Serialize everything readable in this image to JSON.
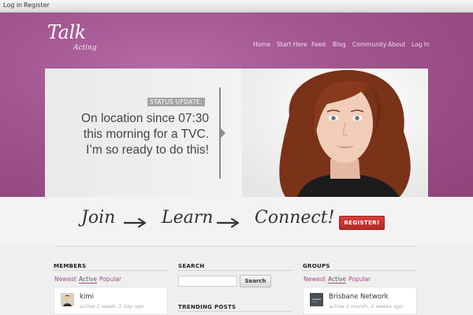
{
  "adminbar": {
    "login": "Log in",
    "register": "Register"
  },
  "logo": {
    "main": "Talk",
    "sub": "Acting"
  },
  "nav": [
    "Home",
    "Start Here",
    "Feed",
    "Blog",
    "Community",
    "About",
    "Log In"
  ],
  "hero": {
    "status_label": "STATUS UPDATE:",
    "lines": [
      "On location since 07:30",
      "this morning for a TVC.",
      "I’m so ready to do this!"
    ]
  },
  "join": {
    "step1": "Join",
    "step2": "Learn",
    "step3": "Connect!",
    "register_label": "REGISTER!"
  },
  "members": {
    "title": "MEMBERS",
    "tabs": [
      "Newest",
      "Active",
      "Popular"
    ],
    "item": {
      "name": "kimi",
      "meta": "active 1 week, 1 day ago"
    }
  },
  "search": {
    "title": "SEARCH",
    "button_label": "Search"
  },
  "trending": {
    "title": "TRENDING POSTS"
  },
  "groups": {
    "title": "GROUPS",
    "tabs": [
      "Newest",
      "Active",
      "Popular"
    ],
    "item": {
      "name": "Brisbane Network",
      "meta": "active 1 month, 2 weeks ago"
    }
  },
  "colors": {
    "header": "#a2558f",
    "accent": "#a04c8c",
    "register": "#c93532"
  },
  "icons": [
    "arrow-right-icon",
    "member-avatar",
    "group-avatar"
  ]
}
